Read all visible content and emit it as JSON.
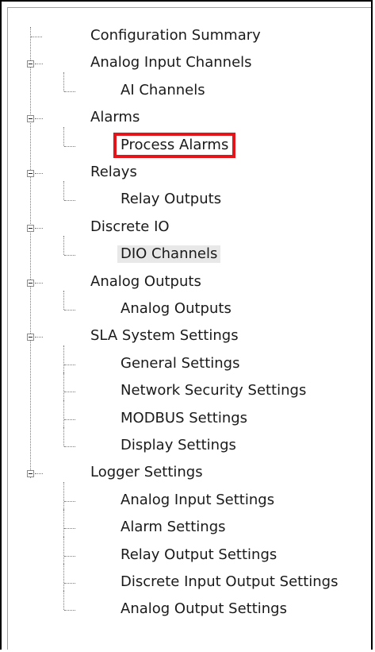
{
  "tree": [
    {
      "id": "config-summary",
      "label": "Configuration Summary",
      "level": 0,
      "expander": false
    },
    {
      "id": "analog-input-channels",
      "label": "Analog Input Channels",
      "level": 0,
      "expander": true
    },
    {
      "id": "ai-channels",
      "label": "AI Channels",
      "level": 1
    },
    {
      "id": "alarms",
      "label": "Alarms",
      "level": 0,
      "expander": true
    },
    {
      "id": "process-alarms",
      "label": "Process Alarms",
      "level": 1,
      "highlighted": true
    },
    {
      "id": "relays",
      "label": "Relays",
      "level": 0,
      "expander": true
    },
    {
      "id": "relay-outputs",
      "label": "Relay Outputs",
      "level": 1
    },
    {
      "id": "discrete-io",
      "label": "Discrete IO",
      "level": 0,
      "expander": true
    },
    {
      "id": "dio-channels",
      "label": "DIO Channels",
      "level": 1,
      "selected": true
    },
    {
      "id": "analog-outputs",
      "label": "Analog Outputs",
      "level": 0,
      "expander": true
    },
    {
      "id": "analog-outputs-child",
      "label": "Analog Outputs",
      "level": 1
    },
    {
      "id": "sla-system-settings",
      "label": "SLA System Settings",
      "level": 0,
      "expander": true
    },
    {
      "id": "general-settings",
      "label": "General Settings",
      "level": 1
    },
    {
      "id": "network-security-settings",
      "label": "Network Security Settings",
      "level": 1
    },
    {
      "id": "modbus-settings",
      "label": "MODBUS Settings",
      "level": 1
    },
    {
      "id": "display-settings",
      "label": "Display Settings",
      "level": 1
    },
    {
      "id": "logger-settings",
      "label": "Logger Settings",
      "level": 0,
      "expander": true
    },
    {
      "id": "analog-input-settings",
      "label": "Analog Input Settings",
      "level": 1
    },
    {
      "id": "alarm-settings",
      "label": "Alarm Settings",
      "level": 1
    },
    {
      "id": "relay-output-settings",
      "label": "Relay Output Settings",
      "level": 1
    },
    {
      "id": "discrete-input-output-settings",
      "label": "Discrete Input Output Settings",
      "level": 1
    },
    {
      "id": "analog-output-settings",
      "label": "Analog Output Settings",
      "level": 1
    }
  ],
  "colors": {
    "highlight": "#e4141b",
    "selected_bg": "#e8e8e8",
    "tree_line": "#7a7a7a"
  }
}
